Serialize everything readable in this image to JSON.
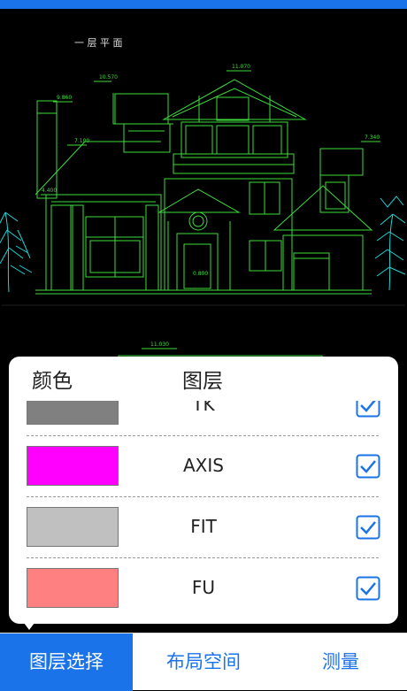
{
  "canvas": {
    "plan_title": "一 层 平 面",
    "dims": [
      "10.570",
      "11.070",
      "9.860",
      "7.100",
      "7.340",
      "4.400",
      "0.800",
      "11.030"
    ]
  },
  "layer_panel": {
    "col_color": "颜色",
    "col_layer": "图层",
    "layers": [
      {
        "name": "TK",
        "color": "#808080",
        "checked": true
      },
      {
        "name": "AXIS",
        "color": "#ff00ff",
        "checked": true
      },
      {
        "name": "FIT",
        "color": "#c0c0c0",
        "checked": true
      },
      {
        "name": "FU",
        "color": "#ff8080",
        "checked": true
      }
    ]
  },
  "tabs": [
    {
      "label": "图层选择",
      "active": true
    },
    {
      "label": "布局空间",
      "active": false
    },
    {
      "label": "测量",
      "active": false
    }
  ],
  "colors": {
    "accent": "#1a73e8",
    "drawing_green": "#3ddc3d",
    "tree_cyan": "#1ad6d6"
  }
}
